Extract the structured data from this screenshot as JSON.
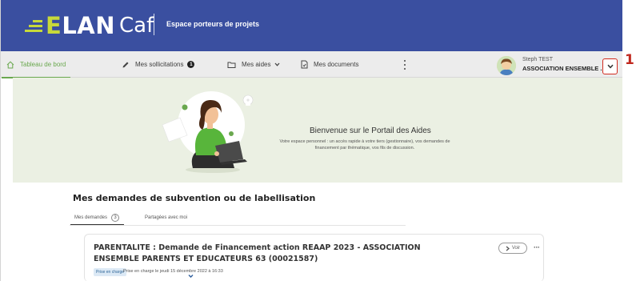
{
  "header": {
    "logo_text_first": "E",
    "logo_text_rest": "LAN",
    "logo_caf": "Caf",
    "subtitle": "Espace porteurs de projets"
  },
  "nav": {
    "items": [
      {
        "label": "Tableau de bord",
        "icon": "home-icon",
        "active": true
      },
      {
        "label": "Mes sollicitations",
        "icon": "pencil-icon",
        "badge": "1"
      },
      {
        "label": "Mes aides",
        "icon": "folder-icon",
        "has_dropdown": true
      },
      {
        "label": "Mes documents",
        "icon": "document-icon"
      }
    ],
    "more_icon": "kebab-menu-icon"
  },
  "user": {
    "name": "Steph TEST",
    "organization": "ASSOCIATION ENSEMBLE ..."
  },
  "annotation": {
    "callout_number": "1",
    "color": "#c0281e"
  },
  "banner": {
    "title": "Bienvenue sur le Portail des Aides",
    "description": "Votre espace personnel : un accès rapide à votre tiers (gestionnaire), vos demandes de financement par thématique, vos fils de discussion."
  },
  "section": {
    "title": "Mes demandes de subvention ou de labellisation",
    "tabs": [
      {
        "label": "Mes demandes",
        "count": "3",
        "active": true
      },
      {
        "label": "Partagées avec moi"
      }
    ]
  },
  "request_card": {
    "title": "PARENTALITE : Demande de Financement action REAAP 2023 - ASSOCIATION ENSEMBLE PARENTS ET EDUCATEURS 63 (00021587)",
    "status_badge": "Prise en charge",
    "status_text": "Prise en charge le jeudi 15 décembre 2022 à 16:33",
    "view_button": "Voir",
    "more_icon": "more-horizontal-icon"
  },
  "colors": {
    "header_bg": "#3a4fa0",
    "logo_accent": "#c7d93a",
    "active_nav": "#6aa84f",
    "banner_bg": "#ebf0e3"
  }
}
